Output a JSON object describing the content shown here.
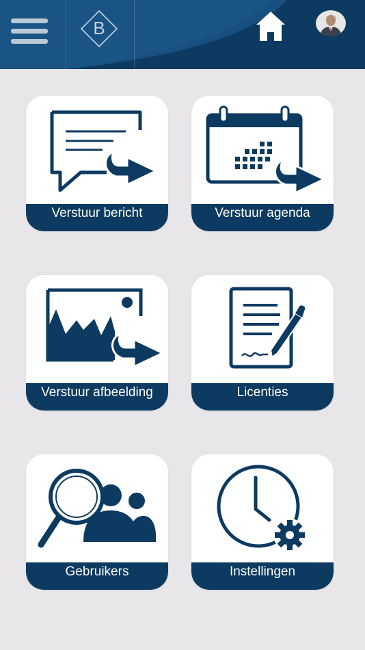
{
  "header": {
    "menu_icon": "hamburger-menu-icon",
    "logo_letter": "B",
    "home_icon": "home-icon",
    "avatar_icon": "user-avatar",
    "colors": {
      "background": "#0c3a60",
      "swoosh": "#1e5a8a"
    }
  },
  "tiles": [
    {
      "label": "Verstuur bericht",
      "icon": "message-send-icon"
    },
    {
      "label": "Verstuur agenda",
      "icon": "calendar-send-icon"
    },
    {
      "label": "Verstuur afbeelding",
      "icon": "image-send-icon"
    },
    {
      "label": "Licenties",
      "icon": "license-document-icon"
    },
    {
      "label": "Gebruikers",
      "icon": "users-search-icon"
    },
    {
      "label": "Instellingen",
      "icon": "clock-settings-icon"
    }
  ],
  "colors": {
    "page_background": "#e8e6e8",
    "accent": "#0c3a60",
    "tile_background": "#ffffff"
  }
}
